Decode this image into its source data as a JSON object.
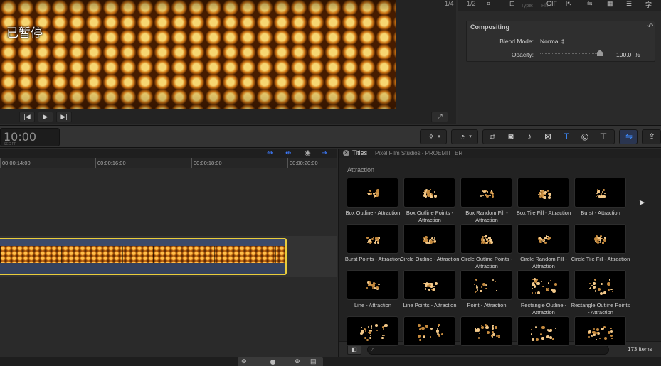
{
  "viewer": {
    "status_text": "已暂停"
  },
  "inspector": {
    "top_labels": [
      "1/4",
      "1/2"
    ],
    "type_label": "Type:",
    "type_value": "Fill",
    "compositing": {
      "title": "Compositing",
      "blend_mode_label": "Blend Mode:",
      "blend_mode_value": "Normal ‡",
      "opacity_label": "Opacity:",
      "opacity_value": "100.0",
      "opacity_unit": "%",
      "opacity_level": 1.0
    }
  },
  "toolbar": {
    "timecode": "10:00",
    "timecode_sub": "SEC    FR"
  },
  "timeline": {
    "ruler": [
      "00:00:14:00",
      "00:00:16:00",
      "00:00:18:00",
      "00:00:20:00"
    ]
  },
  "browser": {
    "title": "Titles",
    "subtitle": "Pixel Film Studios - PROEMITTER",
    "category": "Attraction",
    "item_count": "173 items",
    "items": [
      {
        "label": "Box Outline - Attraction"
      },
      {
        "label": "Box Outline Points - Attraction"
      },
      {
        "label": "Box Random Fill - Attraction"
      },
      {
        "label": "Box Tile Fill - Attraction"
      },
      {
        "label": "Burst - Attraction"
      },
      {
        "label": "Burst Points - Attraction"
      },
      {
        "label": "Circle Outline - Attraction"
      },
      {
        "label": "Circle Outline Points - Attraction"
      },
      {
        "label": "Circle Random Fill - Attraction"
      },
      {
        "label": "Circle Tile Fill - Attraction"
      },
      {
        "label": "Line - Attraction"
      },
      {
        "label": "Line Points - Attraction"
      },
      {
        "label": "Point - Attraction"
      },
      {
        "label": "Rectangle Outline - Attraction"
      },
      {
        "label": "Rectangle Outline Points - Attraction"
      },
      {
        "label": ""
      },
      {
        "label": ""
      },
      {
        "label": ""
      },
      {
        "label": ""
      },
      {
        "label": ""
      }
    ]
  },
  "colors": {
    "accent_blue": "#2f6fe0",
    "clip_border": "#e8cc3c",
    "honeycomb": "#d98a1e"
  }
}
